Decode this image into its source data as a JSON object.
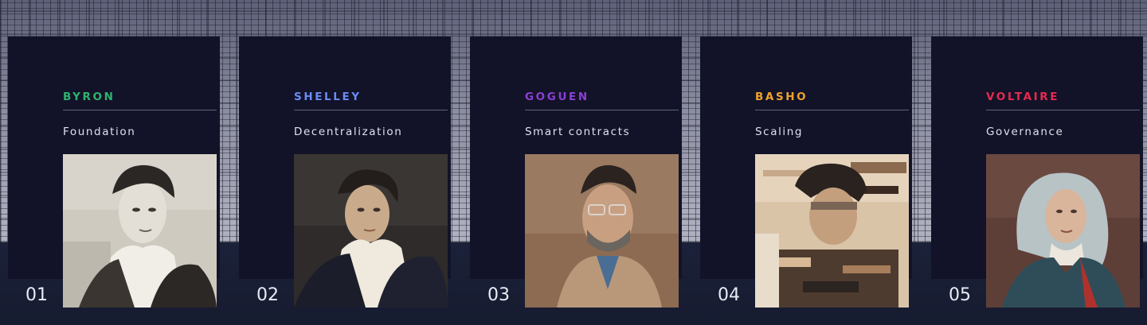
{
  "cards": [
    {
      "number": "01",
      "name": "BYRON",
      "topic": "Foundation",
      "accent": "#2fb36e",
      "portrait_icon": "byron-portrait"
    },
    {
      "number": "02",
      "name": "SHELLEY",
      "topic": "Decentralization",
      "accent": "#6a8cf5",
      "portrait_icon": "shelley-portrait"
    },
    {
      "number": "03",
      "name": "GOGUEN",
      "topic": "Smart contracts",
      "accent": "#8b3fd4",
      "portrait_icon": "goguen-portrait"
    },
    {
      "number": "04",
      "name": "BASHO",
      "topic": "Scaling",
      "accent": "#f0a22c",
      "portrait_icon": "basho-portrait"
    },
    {
      "number": "05",
      "name": "VOLTAIRE",
      "topic": "Governance",
      "accent": "#e8294f",
      "portrait_icon": "voltaire-portrait"
    }
  ]
}
